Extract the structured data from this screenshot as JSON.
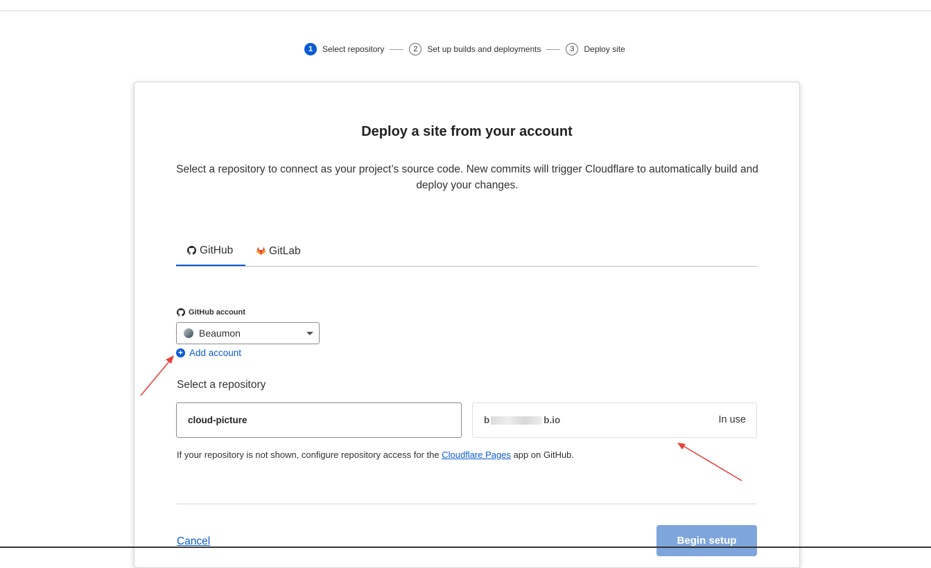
{
  "stepper": {
    "steps": [
      {
        "num": "1",
        "label": "Select repository"
      },
      {
        "num": "2",
        "label": "Set up builds and deployments"
      },
      {
        "num": "3",
        "label": "Deploy site"
      }
    ]
  },
  "main": {
    "title": "Deploy a site from your account",
    "description": "Select a repository to connect as your project’s source code. New commits will trigger Cloudflare to automatically build and deploy your changes.",
    "tabs": [
      {
        "label": "GitHub",
        "icon": "github-icon"
      },
      {
        "label": "GitLab",
        "icon": "gitlab-icon"
      }
    ],
    "account_label": "GitHub account",
    "account_selected": "Beaumon",
    "add_account": "Add account",
    "select_repo_label": "Select a repository",
    "repos": [
      {
        "name": "cloud-picture"
      },
      {
        "name_prefix": "b",
        "name_suffix": "b.io",
        "status": "In use"
      }
    ],
    "help_prefix": "If your repository is not shown, configure repository access for the ",
    "help_link": "Cloudflare Pages",
    "help_suffix": " app on GitHub.",
    "cancel": "Cancel",
    "begin": "Begin setup"
  },
  "colors": {
    "accent": "#0b5cd5",
    "annotation_arrow": "#e8413b"
  }
}
